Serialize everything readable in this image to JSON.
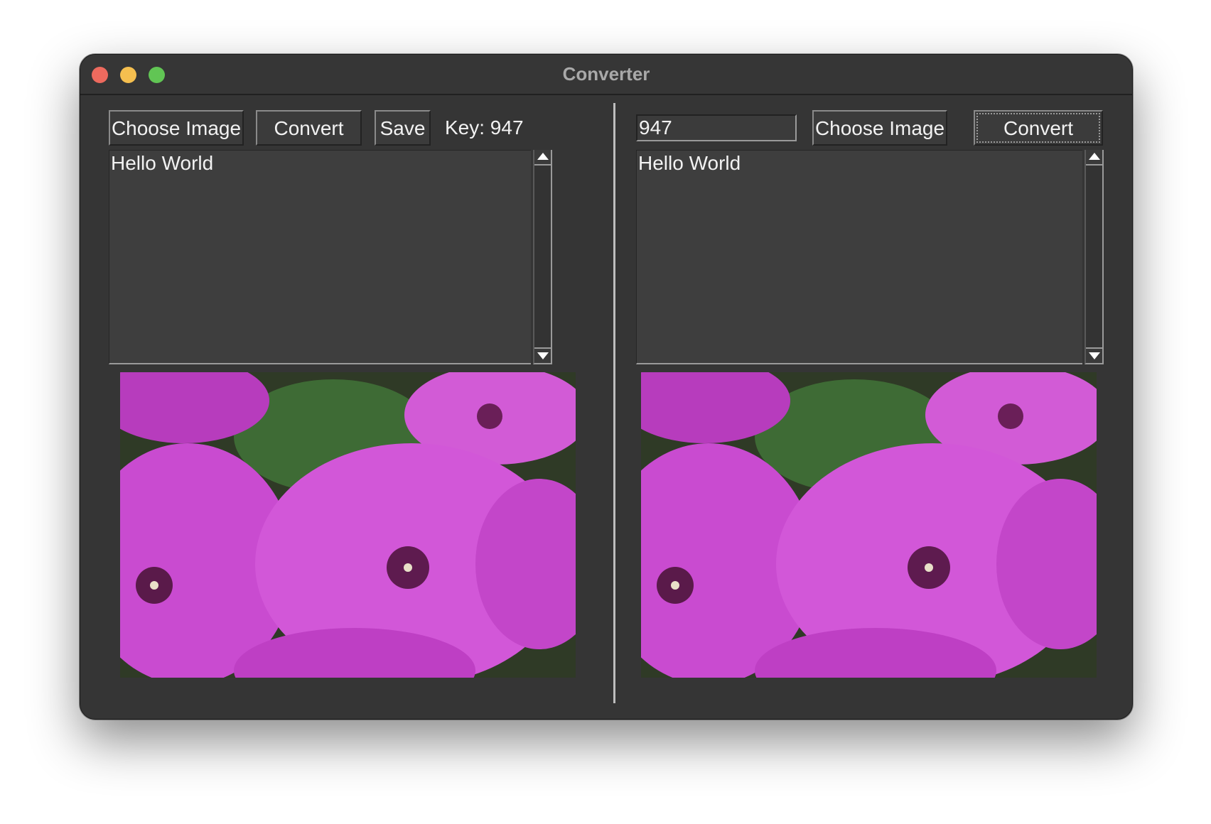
{
  "window": {
    "title": "Converter"
  },
  "left_panel": {
    "choose_image_label": "Choose Image",
    "convert_label": "Convert",
    "save_label": "Save",
    "key_label": "Key: 947",
    "text_content": "Hello World"
  },
  "right_panel": {
    "key_input_value": "947",
    "choose_image_label": "Choose Image",
    "convert_label": "Convert",
    "text_content": "Hello World"
  },
  "colors": {
    "window_bg": "#353535",
    "flower_magenta": "#c94bd0",
    "leaf_green": "#3e6b35"
  },
  "icons": [
    "traffic-light-close",
    "traffic-light-minimize",
    "traffic-light-zoom",
    "scroll-up-arrow-icon",
    "scroll-down-arrow-icon"
  ]
}
